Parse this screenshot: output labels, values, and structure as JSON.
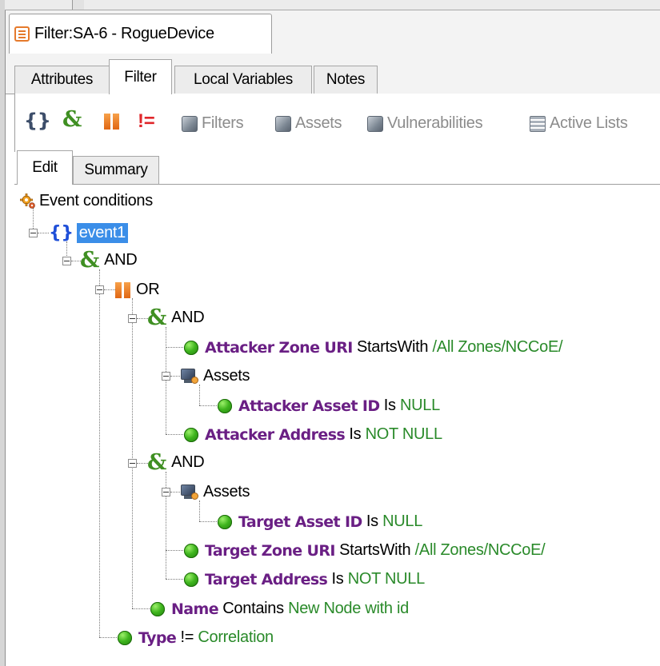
{
  "window": {
    "tab_title": "Filter:SA-6 - RogueDevice"
  },
  "editor_tabs": [
    {
      "label": "Attributes",
      "active": false
    },
    {
      "label": "Filter",
      "active": true
    },
    {
      "label": "Local Variables",
      "active": false
    },
    {
      "label": "Notes",
      "active": false
    }
  ],
  "toolbar": {
    "icons": [
      "braces-icon",
      "and-icon",
      "or-icon",
      "not-equal-icon"
    ],
    "filters_label": "Filters",
    "assets_label": "Assets",
    "vulnerabilities_label": "Vulnerabilities",
    "active_lists_label": "Active Lists"
  },
  "sub_tabs": [
    {
      "label": "Edit",
      "active": true
    },
    {
      "label": "Summary",
      "active": false
    }
  ],
  "tree": {
    "root_label": "Event conditions",
    "event_label": "event1",
    "and_label": "AND",
    "or_label": "OR",
    "and1_label": "AND",
    "and2_label": "AND",
    "assets1_label": "Assets",
    "assets2_label": "Assets",
    "conditions": {
      "attacker_zone_uri": {
        "field": "Attacker Zone URI",
        "op": "StartsWith",
        "value": "/All Zones/NCCoE/"
      },
      "attacker_asset_id": {
        "field": "Attacker Asset ID",
        "op": "Is",
        "value": "NULL"
      },
      "attacker_address": {
        "field": "Attacker Address",
        "op": "Is",
        "value": "NOT NULL"
      },
      "target_asset_id": {
        "field": "Target Asset ID",
        "op": "Is",
        "value": "NULL"
      },
      "target_zone_uri": {
        "field": "Target Zone URI",
        "op": "StartsWith",
        "value": "/All Zones/NCCoE/"
      },
      "target_address": {
        "field": "Target Address",
        "op": "Is",
        "value": "NOT NULL"
      },
      "name": {
        "field": "Name",
        "op": "Contains",
        "value": "New Node with id"
      },
      "type": {
        "field": "Type",
        "op": "!=",
        "value": "Correlation"
      }
    }
  },
  "colors": {
    "selection": "#3b8ee8",
    "field": "#6a1f84",
    "value": "#2a8a2a",
    "braces": "#1f4fd8",
    "and": "#3f8f22",
    "or": "#e06613",
    "not_equal": "#e0262a"
  }
}
